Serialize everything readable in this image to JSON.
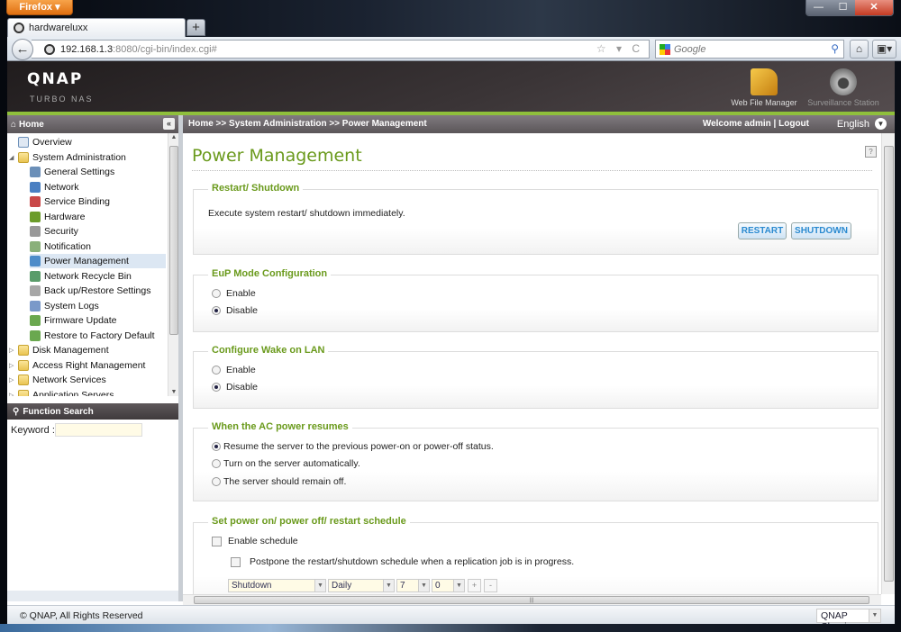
{
  "browser": {
    "app_button": "Firefox ▾",
    "window_controls": {
      "minimize": "—",
      "maximize": "☐",
      "close": "✕"
    },
    "tab_title": "hardwareluxx",
    "new_tab": "+",
    "url_host": "192.168.1.3",
    "url_path": ":8080/cgi-bin/index.cgi#",
    "url_tools": "☆ ▾ C",
    "search_placeholder": "Google",
    "home_icon": "⌂",
    "bookmarks_icon": "▣▾",
    "back_icon": "←"
  },
  "header": {
    "logo": "QNAP",
    "subtitle": "TURBO NAS",
    "apps": [
      {
        "label": "Web File Manager",
        "icon": "folder-magnifier-icon"
      },
      {
        "label": "Surveillance Station",
        "icon": "dome-camera-icon"
      }
    ]
  },
  "sidebar": {
    "home_label": "Home",
    "collapse_icon": "«",
    "tree": [
      {
        "label": "Overview",
        "level": 0,
        "type": "item"
      },
      {
        "label": "System Administration",
        "level": 0,
        "type": "folder",
        "expanded": true
      },
      {
        "label": "General Settings",
        "level": 1
      },
      {
        "label": "Network",
        "level": 1
      },
      {
        "label": "Service Binding",
        "level": 1
      },
      {
        "label": "Hardware",
        "level": 1
      },
      {
        "label": "Security",
        "level": 1
      },
      {
        "label": "Notification",
        "level": 1
      },
      {
        "label": "Power Management",
        "level": 1,
        "selected": true
      },
      {
        "label": "Network Recycle Bin",
        "level": 1
      },
      {
        "label": "Back up/Restore Settings",
        "level": 1
      },
      {
        "label": "System Logs",
        "level": 1
      },
      {
        "label": "Firmware Update",
        "level": 1
      },
      {
        "label": "Restore to Factory Default",
        "level": 1
      },
      {
        "label": "Disk Management",
        "level": 0,
        "type": "folder"
      },
      {
        "label": "Access Right Management",
        "level": 0,
        "type": "folder"
      },
      {
        "label": "Network Services",
        "level": 0,
        "type": "folder"
      },
      {
        "label": "Application Servers",
        "level": 0,
        "type": "folder"
      }
    ],
    "function_search_label": "Function Search",
    "keyword_label": "Keyword :",
    "keyword_value": ""
  },
  "topbar": {
    "breadcrumb": "Home >> System Administration >> Power Management",
    "welcome": "Welcome admin | Logout",
    "language": "English"
  },
  "main": {
    "title": "Power Management",
    "help_icon": "?",
    "restart_section": {
      "legend": "Restart/ Shutdown",
      "description": "Execute system restart/ shutdown immediately.",
      "restart_label": "RESTART",
      "shutdown_label": "SHUTDOWN"
    },
    "eup_section": {
      "legend": "EuP Mode Configuration",
      "options": [
        "Enable",
        "Disable"
      ],
      "selected": "Disable"
    },
    "wol_section": {
      "legend": "Configure Wake on LAN",
      "options": [
        "Enable",
        "Disable"
      ],
      "selected": "Disable"
    },
    "ac_section": {
      "legend": "When the AC power resumes",
      "options": [
        "Resume the server to the previous power-on or power-off status.",
        "Turn on the server automatically.",
        "The server should remain off."
      ],
      "selected": 0
    },
    "schedule_section": {
      "legend": "Set power on/ power off/ restart schedule",
      "enable_label": "Enable schedule",
      "enable_checked": false,
      "postpone_label": "Postpone the restart/shutdown schedule when a replication job is in progress.",
      "postpone_checked": false,
      "action": "Shutdown",
      "frequency": "Daily",
      "hour": "7",
      "minute": "0",
      "add_label": "+",
      "remove_label": "-"
    }
  },
  "footer": {
    "copyright": "© QNAP, All Rights Reserved",
    "theme": "QNAP Classic"
  }
}
